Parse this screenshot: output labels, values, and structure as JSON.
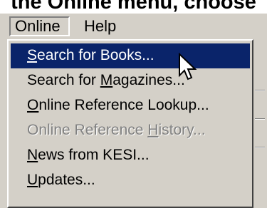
{
  "caption": "the Online menu, choose",
  "menubar": {
    "items": [
      {
        "label": "Online"
      },
      {
        "label": "Help"
      }
    ]
  },
  "menu": {
    "items": [
      {
        "before": "",
        "accel": "S",
        "after": "earch for Books...",
        "state": "selected"
      },
      {
        "before": "Search for ",
        "accel": "M",
        "after": "agazines...",
        "state": "normal"
      },
      {
        "before": "",
        "accel": "O",
        "after": "nline Reference Lookup...",
        "state": "normal"
      },
      {
        "before": "Online Reference ",
        "accel": "H",
        "after": "istory...",
        "state": "disabled"
      },
      {
        "before": "",
        "accel": "N",
        "after": "ews from KESI...",
        "state": "normal"
      },
      {
        "before": "",
        "accel": "U",
        "after": "pdates...",
        "state": "normal"
      }
    ]
  },
  "colors": {
    "face": "#d4d0c8",
    "highlight": "#0a246a",
    "disabled_text": "#808080"
  },
  "icons": {
    "cursor": "arrow-cursor-icon"
  }
}
